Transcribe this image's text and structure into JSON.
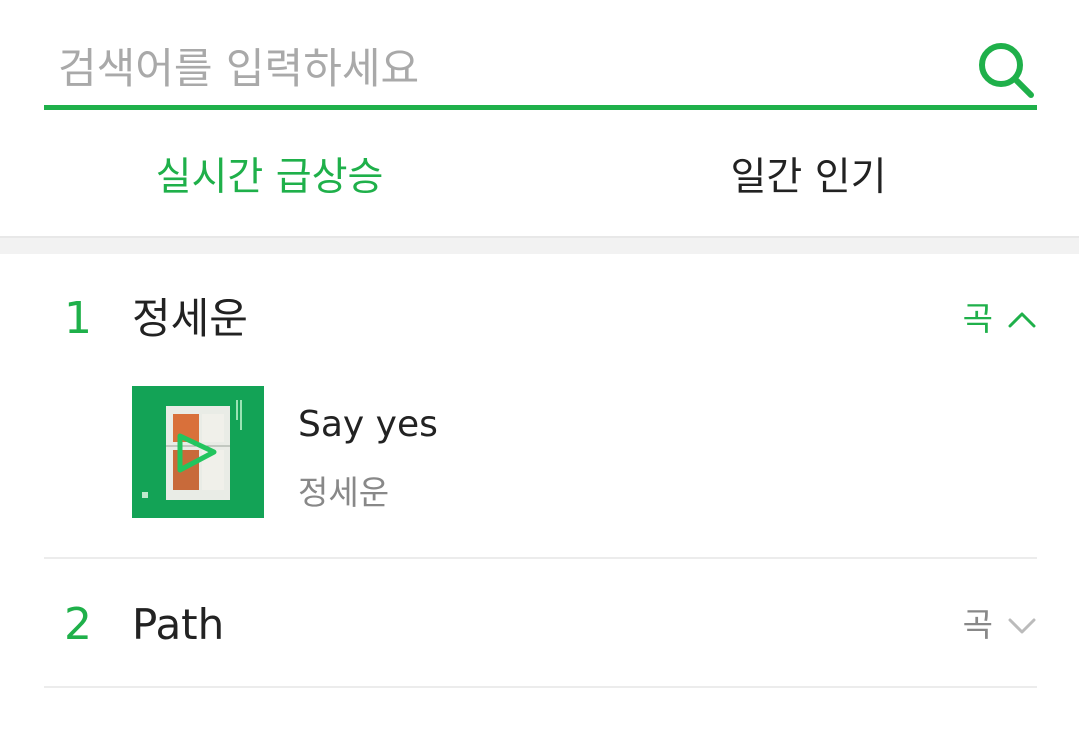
{
  "search": {
    "placeholder": "검색어를 입력하세요",
    "value": "",
    "icon": "search-icon"
  },
  "tabs": [
    {
      "label": "실시간 급상승",
      "active": true
    },
    {
      "label": "일간 인기",
      "active": false
    }
  ],
  "colors": {
    "accent": "#1fb04a",
    "text": "#222222",
    "muted": "#888888"
  },
  "results": [
    {
      "rank": "1",
      "keyword": "정세운",
      "type_label": "곡",
      "expanded": true,
      "icon": "chevron-up-icon",
      "song": {
        "title": "Say yes",
        "artist": "정세운"
      }
    },
    {
      "rank": "2",
      "keyword": "Path",
      "type_label": "곡",
      "expanded": false,
      "icon": "chevron-down-icon"
    }
  ]
}
